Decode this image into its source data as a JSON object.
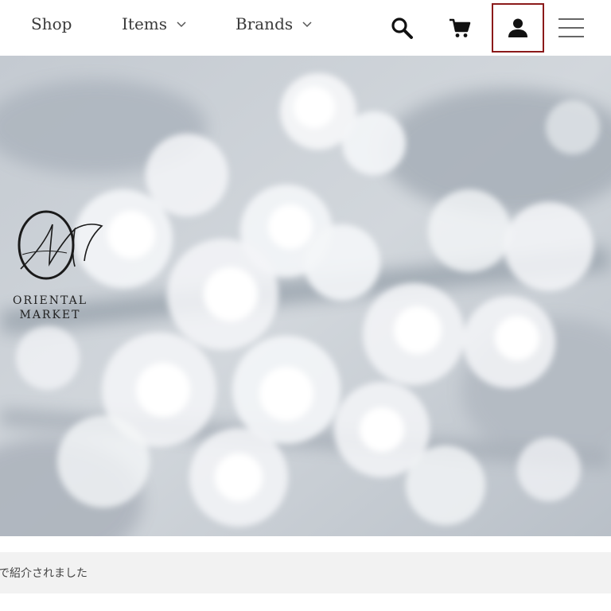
{
  "header": {
    "nav": {
      "shop_label": "Shop",
      "items_label": "Items",
      "brands_label": "Brands"
    },
    "icons": {
      "search": "search-icon",
      "cart": "cart-icon",
      "account": "user-icon",
      "menu": "hamburger-menu-icon"
    },
    "account_highlight_color": "#8b1a1a"
  },
  "hero": {
    "logo": {
      "line1": "ORIENTAL",
      "line2": "MARKET"
    }
  },
  "notice": {
    "text": "で紹介されました"
  }
}
